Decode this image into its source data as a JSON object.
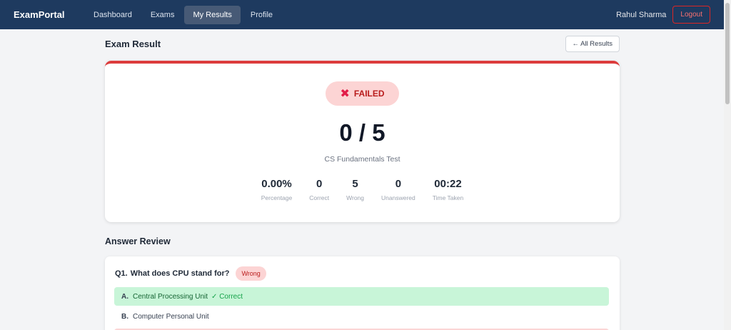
{
  "nav": {
    "brand": "ExamPortal",
    "links": [
      "Dashboard",
      "Exams",
      "My Results",
      "Profile"
    ],
    "user_name": "Rahul Sharma",
    "logout_label": "Logout"
  },
  "page": {
    "title": "Exam Result",
    "back_label": "← All Results"
  },
  "result": {
    "status": "FAILED",
    "score": "0 / 5",
    "exam_name": "CS Fundamentals Test",
    "stats": [
      {
        "value": "0.00%",
        "label": "Percentage"
      },
      {
        "value": "0",
        "label": "Correct"
      },
      {
        "value": "5",
        "label": "Wrong"
      },
      {
        "value": "0",
        "label": "Unanswered"
      },
      {
        "value": "00:22",
        "label": "Time Taken"
      }
    ]
  },
  "review": {
    "title": "Answer Review",
    "questions": [
      {
        "number": "Q1.",
        "text": "What does CPU stand for?",
        "badge": "Wrong",
        "options": [
          {
            "letter": "A.",
            "text": "Central Processing Unit",
            "tag": "✓ Correct"
          },
          {
            "letter": "B.",
            "text": "Computer Personal Unit",
            "tag": ""
          }
        ]
      }
    ]
  },
  "colors": {
    "navbar": "#1e3a5f",
    "fail_accent": "#dc3c3c",
    "correct_bg": "#c8f5d8"
  }
}
